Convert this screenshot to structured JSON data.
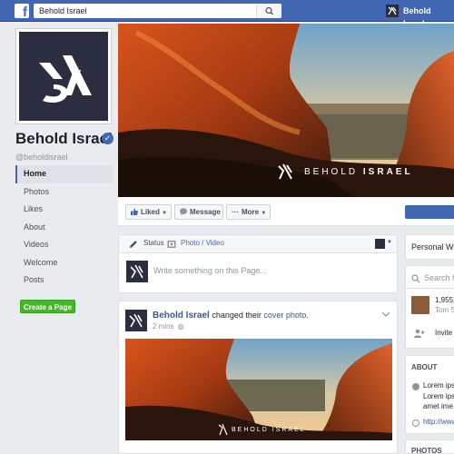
{
  "topbar": {
    "search_value": "Behold Israel",
    "user_name": "Behold Israel"
  },
  "profile": {
    "name": "Behold Israel",
    "handle": "@beholdisrael"
  },
  "nav": {
    "items": [
      {
        "label": "Home"
      },
      {
        "label": "Photos"
      },
      {
        "label": "Likes"
      },
      {
        "label": "About"
      },
      {
        "label": "Videos"
      },
      {
        "label": "Welcome"
      },
      {
        "label": "Posts"
      }
    ],
    "create_page": "Create a Page"
  },
  "cover": {
    "brand_light": "BEHOLD",
    "brand_bold": "ISRAEL"
  },
  "actions": {
    "liked": "Liked",
    "message": "Message",
    "more": "More"
  },
  "composer": {
    "status": "Status",
    "photo_video": "Photo / Video",
    "placeholder": "Write something on this Page..."
  },
  "post": {
    "author": "Behold Israel",
    "action": "changed their",
    "link": "cover photo",
    "period": ".",
    "time": "2 mins",
    "brand": "BEHOLD ISRAEL"
  },
  "right": {
    "personal": "Personal We",
    "search_placeholder": "Search fo",
    "likes_count": "1,955,",
    "likes_name": "Tom S",
    "invite": "Invite f",
    "about_head": "ABOUT",
    "about_line1": "Lorem ips",
    "about_line2": "Lorem ips",
    "about_line3": "amet ime",
    "about_link": "http://www",
    "photos_head": "PHOTOS"
  }
}
